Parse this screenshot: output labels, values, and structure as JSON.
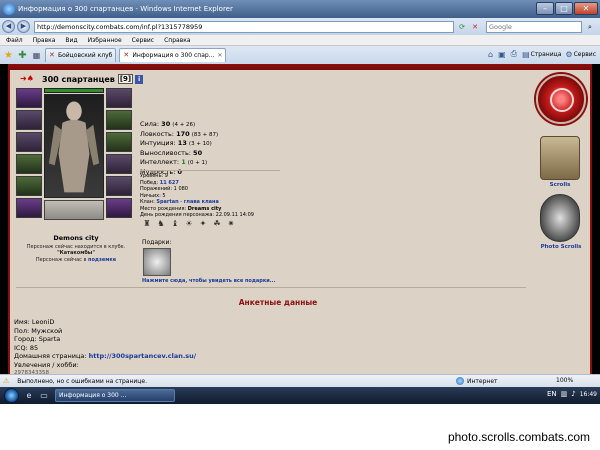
{
  "window": {
    "title": "Информация о 300 спартанцев - Windows Internet Explorer"
  },
  "address": {
    "url": "http://demonscity.combats.com/inf.pl?1315778959",
    "search_placeholder": "Google"
  },
  "menu": {
    "items": [
      "Файл",
      "Правка",
      "Вид",
      "Избранное",
      "Сервис",
      "Справка"
    ]
  },
  "tabs": [
    {
      "label": "Бойцовский клуб"
    },
    {
      "label": "Информация о 300 спар..."
    }
  ],
  "tools": {
    "page_label": "Страница",
    "service_label": "Сервис"
  },
  "character": {
    "name": "300 спартанцев",
    "level": "[9]",
    "info_glyph": "i",
    "city": "Demons city",
    "location_line": "Персонаж сейчас находится в клубе.",
    "location_name": "\"Катакомбы\"",
    "location_sub_prefix": "Персонаж сейчас в",
    "location_sub_link": "подземке"
  },
  "stats": [
    {
      "label": "Сила:",
      "value": "30",
      "bonus": "(4 + 26)"
    },
    {
      "label": "Ловкость:",
      "value": "170",
      "bonus": "(83 + 87)"
    },
    {
      "label": "Интуиция:",
      "value": "13",
      "bonus": "(3 + 10)"
    },
    {
      "label": "Выносливость:",
      "value": "50",
      "bonus": ""
    },
    {
      "label": "Интеллект:",
      "value": "1",
      "bonus": "(0 + 1)"
    },
    {
      "label": "Мудрость:",
      "value": "0",
      "bonus": ""
    }
  ],
  "details": {
    "level_line": "Уровень: 9",
    "wins_label": "Побед:",
    "wins_value": "11 627",
    "losses_line": "Поражений: 1 080",
    "draws_line": "Ничьих: 5",
    "clan_label": "Клан:",
    "clan_name": "Spartan",
    "clan_role": "глава клана",
    "birthplace_label": "Место рождения:",
    "birthplace_value": "Dreams city",
    "birthday_line": "День рождения персонажа: 22.09.11 14:09"
  },
  "medals": [
    "♜",
    "♞",
    "♝",
    "☀",
    "✦",
    "☘",
    "✷"
  ],
  "gifts": {
    "label": "Подарки:",
    "link": "Нажмите сюда, чтобы увидеть все подарки..."
  },
  "side": {
    "scrolls_label": "Scrolls",
    "photo_label": "Photo Scrolls"
  },
  "profile": {
    "heading": "Анкетные данные",
    "name_line": "Имя: LeoniD",
    "sex_line": "Пол: Мужской",
    "city_line": "Город: Sparta",
    "icq_line": "ICQ: 85",
    "homepage_label": "Домашняя страница:",
    "homepage_url": "http://300spartancev.clan.su/",
    "hobby_label": "Увлечения / хобби:",
    "hobby_value": "2978343358"
  },
  "status": {
    "text": "Выполнено, но с ошибками на странице.",
    "zone": "Интернет",
    "zoom": "100%"
  },
  "taskbar": {
    "window_label": "Информация о 300 ...",
    "clock": "16:49"
  },
  "watermark": "photo.scrolls.combats.com"
}
